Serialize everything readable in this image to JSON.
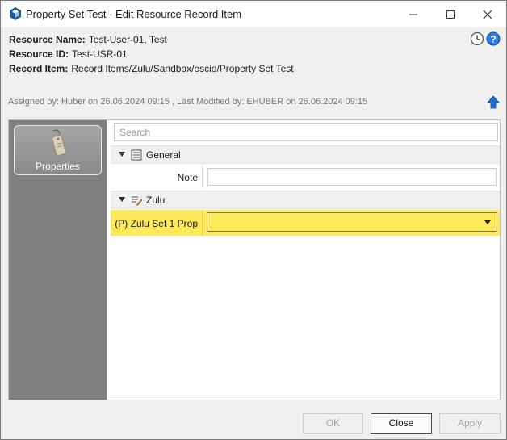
{
  "window": {
    "title": "Property Set Test - Edit Resource Record Item",
    "minimize_glyph": "—",
    "maximize_glyph": "☐",
    "close_glyph": "✕"
  },
  "header": {
    "fields": [
      {
        "label": "Resource Name:",
        "value": "Test-User-01, Test"
      },
      {
        "label": "Resource ID:",
        "value": "Test-USR-01"
      },
      {
        "label": "Record Item:",
        "value": "Record Items/Zulu/Sandbox/escio/Property Set Test"
      }
    ],
    "assigned_text": "Assigned by: Huber on 26.06.2024 09:15 ,  Last Modified by: EHUBER on 26.06.2024 09:15",
    "icons": [
      "history-icon",
      "help-icon",
      "upload-arrow-icon"
    ]
  },
  "sidebar": {
    "items": [
      {
        "label": "Properties",
        "icon": "tag-icon",
        "selected": true
      }
    ]
  },
  "search": {
    "placeholder": "Search",
    "value": ""
  },
  "groups": [
    {
      "name": "General",
      "icon": "list-icon",
      "properties": [
        {
          "label": "Note",
          "value": "",
          "control": "text"
        }
      ]
    },
    {
      "name": "Zulu",
      "icon": "list-edit-icon",
      "properties": [
        {
          "label": "(P) Zulu Set 1 Prop",
          "value": "",
          "control": "dropdown",
          "highlighted": true
        }
      ]
    }
  ],
  "footer": {
    "ok_label": "OK",
    "close_label": "Close",
    "apply_label": "Apply"
  },
  "colors": {
    "highlight": "#fde95a",
    "sidebar": "#7f7f7f",
    "accent_blue": "#1f6fd1"
  }
}
